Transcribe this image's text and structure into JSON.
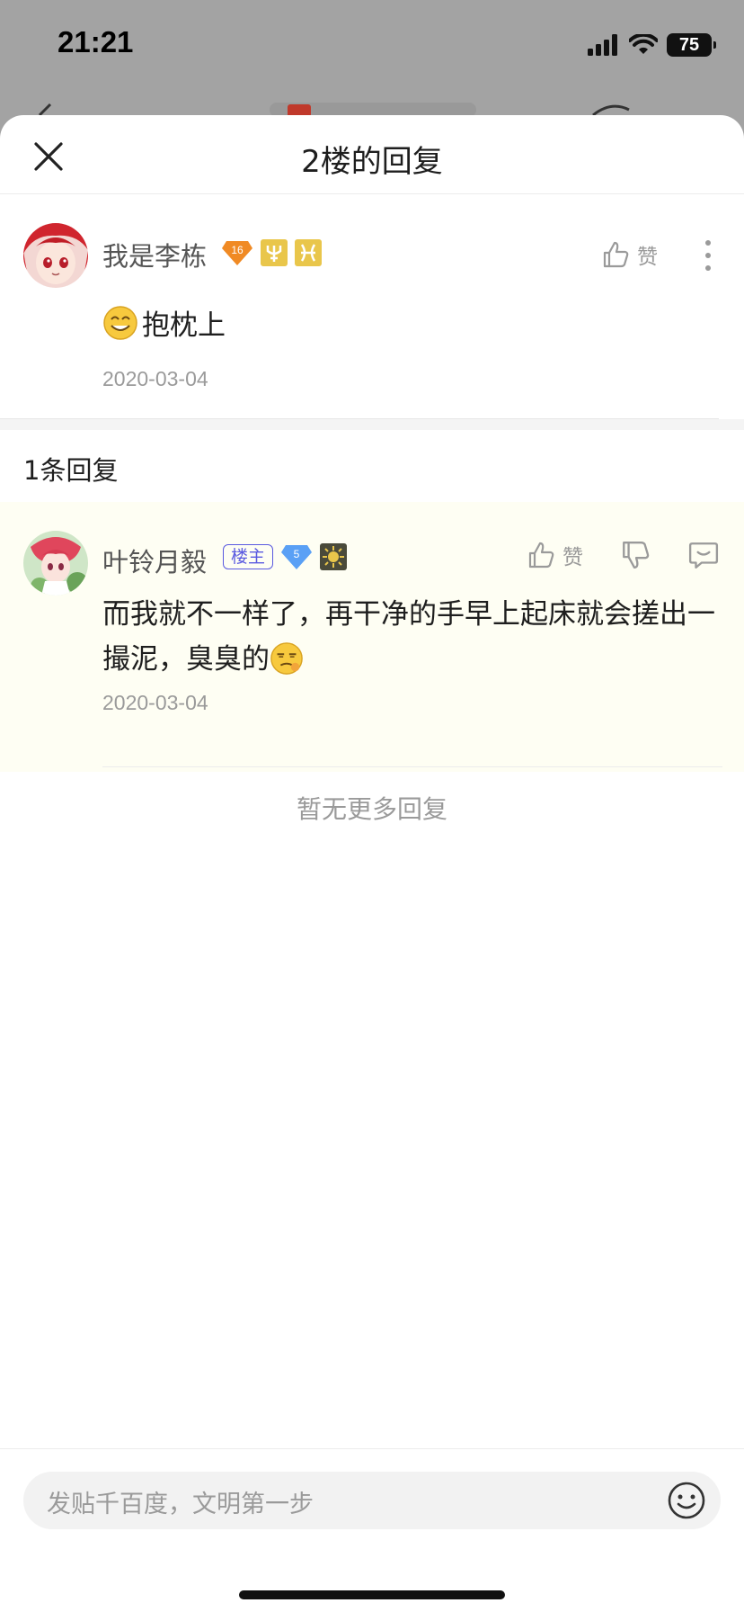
{
  "status_bar": {
    "time": "21:21",
    "battery": "75"
  },
  "sheet": {
    "title": "2楼的回复"
  },
  "post": {
    "username": "我是李栋",
    "level_badge": "16",
    "like_label": "赞",
    "text": "抱枕上",
    "date": "2020-03-04"
  },
  "replies_header": {
    "count_label": "1条回复"
  },
  "reply": {
    "username": "叶铃月毅",
    "owner_tag": "楼主",
    "level_badge": "5",
    "like_label": "赞",
    "text": "而我就不一样了，再干净的手早上起床就会搓出一撮泥，臭臭的",
    "date": "2020-03-04"
  },
  "no_more_label": "暂无更多回复",
  "input": {
    "placeholder": "发贴千百度，文明第一步"
  },
  "colors": {
    "accent_owner": "#5a5ae0",
    "reply_bg": "#fefef3",
    "diamond_orange": "#f08a24",
    "diamond_blue": "#5aa0f5"
  }
}
